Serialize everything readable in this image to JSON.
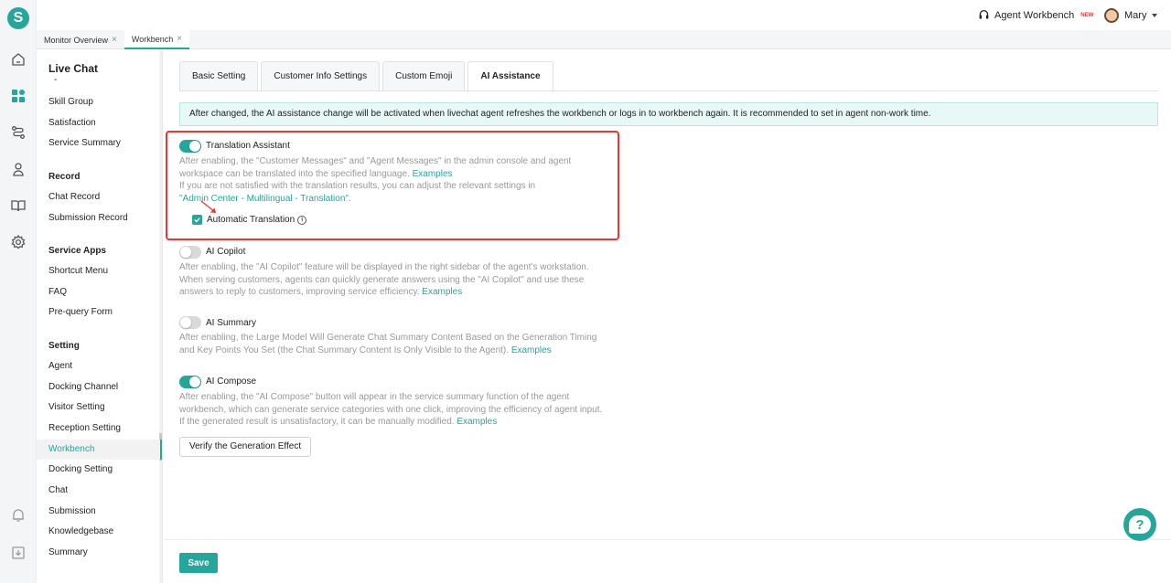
{
  "colors": {
    "accent": "#26a69a",
    "danger": "#e53935",
    "muted": "#999999"
  },
  "logo": {
    "letter": "S"
  },
  "rail": {
    "icons": [
      "home-icon",
      "apps-icon",
      "routing-icon",
      "contacts-icon",
      "book-icon",
      "gear-icon",
      "bell-icon",
      "download-icon"
    ]
  },
  "header": {
    "agent_workbench": "Agent Workbench",
    "new_badge": "NEW",
    "user_name": "Mary"
  },
  "page_tabs": [
    {
      "label": "Monitor Overview",
      "close": "×"
    },
    {
      "label": "Workbench",
      "close": "×"
    }
  ],
  "menu": {
    "top_title": "Live Chat",
    "top_dash": "-",
    "live_chat_items": [
      "Skill Group",
      "Satisfaction",
      "Service Summary"
    ],
    "record_title": "Record",
    "record_items": [
      "Chat Record",
      "Submission Record"
    ],
    "service_apps_title": "Service Apps",
    "service_apps_items": [
      "Shortcut Menu",
      "FAQ",
      "Pre-query Form"
    ],
    "setting_title": "Setting",
    "setting_items": [
      "Agent",
      "Docking Channel",
      "Visitor Setting",
      "Reception Setting",
      "Workbench",
      "Docking Setting",
      "Chat",
      "Submission",
      "Knowledgebase",
      "Summary"
    ],
    "active_item": "Workbench"
  },
  "content_tabs": [
    "Basic Setting",
    "Customer Info Settings",
    "Custom Emoji",
    "AI Assistance"
  ],
  "active_tab": "AI Assistance",
  "notice": "After changed, the AI assistance change will be activated when livechat agent refreshes the workbench or logs in to workbench again. It is recommended to set in agent non-work time.",
  "translation": {
    "title": "Translation Assistant",
    "enabled": true,
    "desc_line1": "After enabling, the \"Customer Messages\" and \"Agent Messages\" in the admin console and agent",
    "desc_line2": "workspace can be translated into the specified language.",
    "examples": "Examples",
    "desc_line3": "If you are not satisfied with the translation results, you can adjust the relevant settings in",
    "admin_link": "\"Admin Center - Multilingual - Translation\"",
    "period": ".",
    "auto_label": "Automatic Translation",
    "auto_checked": true
  },
  "copilot": {
    "title": "AI Copilot",
    "enabled": false,
    "desc_line1": "After enabling, the \"AI Copilot\" feature will be displayed in the right sidebar of the agent's workstation.",
    "desc_line2": "When serving customers, agents can quickly generate answers using the \"AI Copilot\" and use these",
    "desc_line3": "answers to reply to customers, improving service efficiency.",
    "examples": "Examples"
  },
  "summary": {
    "title": "AI Summary",
    "enabled": false,
    "desc_line1": "After enabling, the Large Model Will Generate Chat Summary Content Based on the Generation Timing",
    "desc_line2": "and Key Points You Set (the Chat Summary Content Is Only Visible to the Agent).",
    "examples": "Examples"
  },
  "compose": {
    "title": "AI Compose",
    "enabled": true,
    "desc_line1": "After enabling, the \"AI Compose\" button will appear in the service summary function of the agent",
    "desc_line2": "workbench, which can generate service categories with one click, improving the efficiency of agent input.",
    "desc_line3": "If the generated result is unsatisfactory, it can be manually modified.",
    "examples": "Examples",
    "verify_button": "Verify the Generation Effect"
  },
  "footer": {
    "save_label": "Save"
  },
  "help": {
    "glyph": "?"
  }
}
